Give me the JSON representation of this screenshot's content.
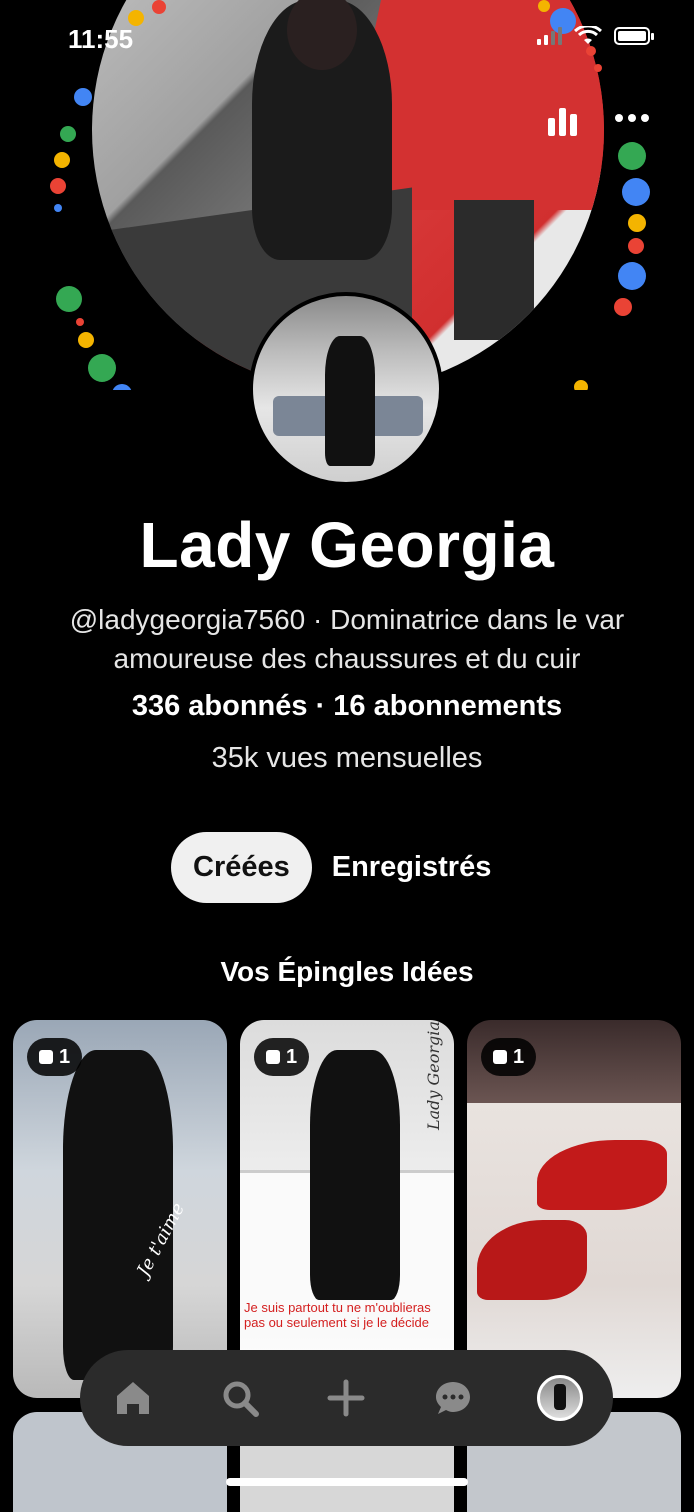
{
  "status_bar": {
    "time": "11:55"
  },
  "profile": {
    "name": "Lady Georgia",
    "bio": "@ladygeorgia7560 · Dominatrice dans le var amoureuse des chaussures et du cuir",
    "follows": "336 abonnés · 16 abonnements",
    "monthly_views": "35k vues mensuelles"
  },
  "tabs": [
    {
      "label": "Créées",
      "active": true
    },
    {
      "label": "Enregistrés",
      "active": false
    }
  ],
  "section": {
    "title": "Vos Épingles Idées"
  },
  "pins": [
    {
      "count": "1",
      "overlay_text": "Je t'aime"
    },
    {
      "count": "1",
      "overlay_text": "Lady Georgia",
      "caption": "Je suis partout tu ne m'oublieras pas ou seulement si je le décide"
    },
    {
      "count": "1"
    }
  ],
  "nav": {
    "icons": [
      "home-icon",
      "search-icon",
      "add-icon",
      "messages-icon",
      "profile-avatar"
    ]
  },
  "colors": {
    "background": "#000000",
    "nav_bg": "#2b2b2b",
    "active_tab_bg": "#f0f0f0",
    "caption_red": "#d42020"
  }
}
